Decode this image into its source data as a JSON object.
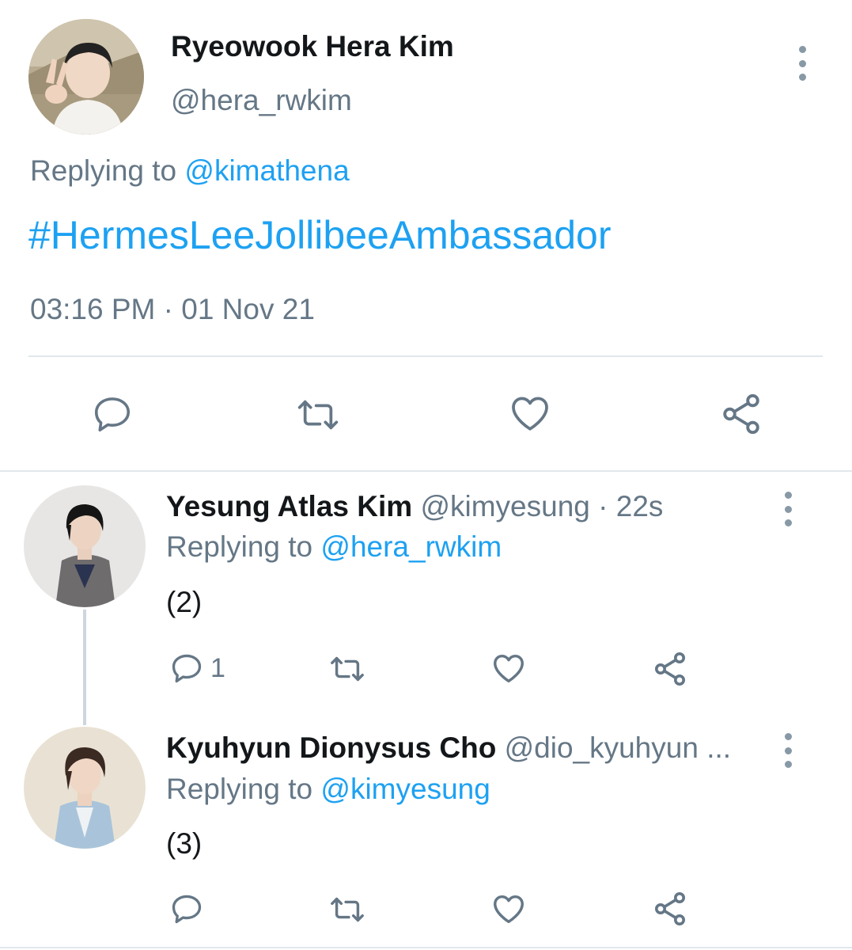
{
  "main_tweet": {
    "author_name": "Ryeowook Hera Kim",
    "author_handle": "@hera_rwkim",
    "replying_prefix": "Replying to ",
    "replying_to": "@kimathena",
    "hashtag": "#HermesLeeJollibeeAmbassador",
    "timestamp": "03:16 PM · 01 Nov 21"
  },
  "replies": [
    {
      "author_name": "Yesung Atlas Kim",
      "meta": "@kimyesung · 22s",
      "replying_prefix": "Replying to ",
      "replying_to": "@hera_rwkim",
      "text": "(2)",
      "reply_count": "1"
    },
    {
      "author_name": "Kyuhyun Dionysus Cho",
      "meta": "@dio_kyuhyun ...",
      "replying_prefix": "Replying to ",
      "replying_to": "@kimyesung",
      "text": "(3)",
      "reply_count": ""
    }
  ],
  "icons": [
    "reply-icon",
    "retweet-icon",
    "like-icon",
    "share-icon",
    "more-options-icon"
  ],
  "colors": {
    "link": "#1da1f2",
    "secondary_text": "#657786",
    "icon": "#657786",
    "divider": "#e1e8ed"
  }
}
